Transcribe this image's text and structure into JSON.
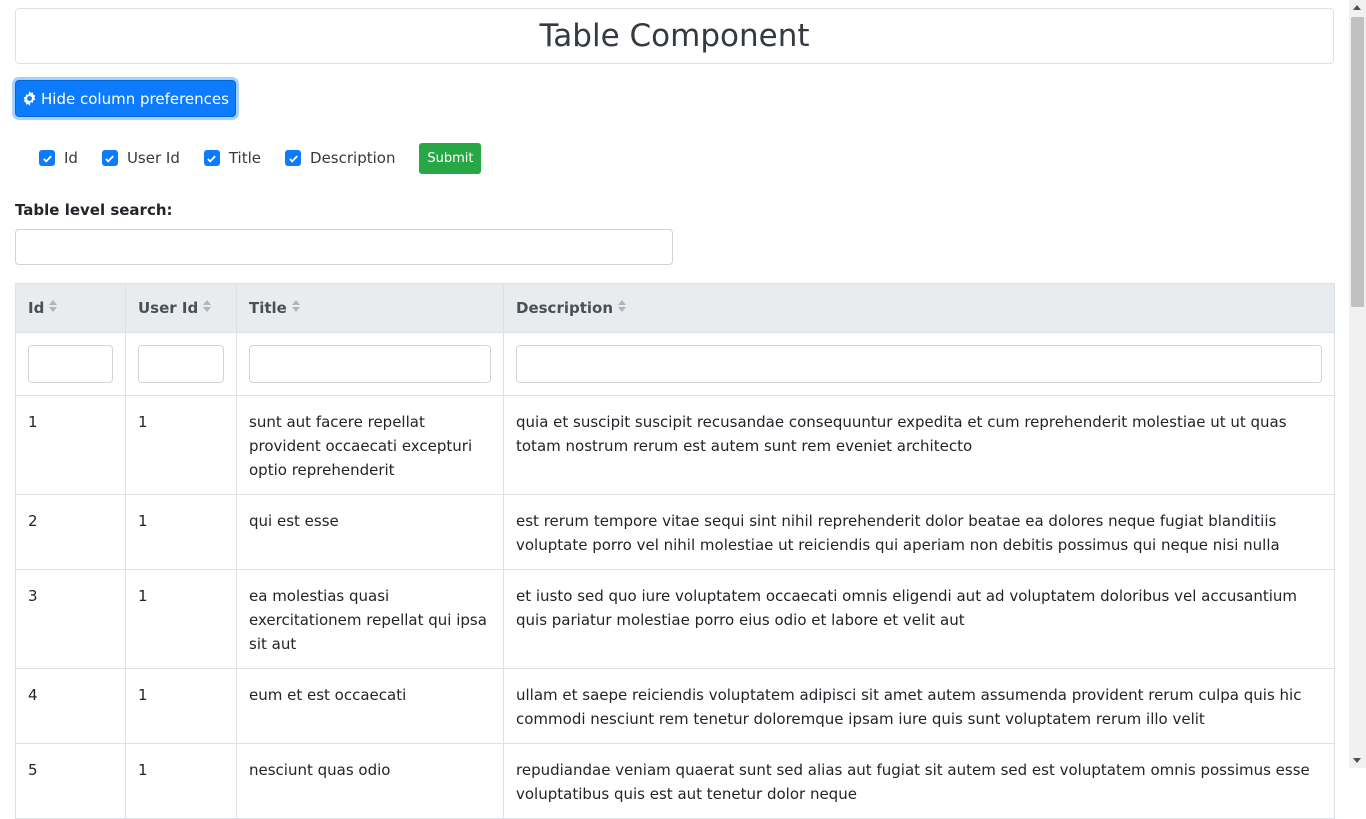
{
  "page": {
    "title": "Table Component"
  },
  "column_prefs": {
    "toggle_label": "Hide column preferences",
    "toggle_icon": "gear-icon",
    "accent_color": "#0d7bfe",
    "options": [
      {
        "label": "Id",
        "checked": true
      },
      {
        "label": "User Id",
        "checked": true
      },
      {
        "label": "Title",
        "checked": true
      },
      {
        "label": "Description",
        "checked": true
      }
    ],
    "submit_label": "Submit",
    "submit_color": "#28a745"
  },
  "search": {
    "label": "Table level search:",
    "value": ""
  },
  "table": {
    "columns": [
      "Id",
      "User Id",
      "Title",
      "Description"
    ],
    "rows": [
      {
        "id": "1",
        "user_id": "1",
        "title": "sunt aut facere repellat provident occaecati excepturi optio reprehenderit",
        "description": "quia et suscipit suscipit recusandae consequuntur expedita et cum reprehenderit molestiae ut ut quas totam nostrum rerum est autem sunt rem eveniet architecto"
      },
      {
        "id": "2",
        "user_id": "1",
        "title": "qui est esse",
        "description": "est rerum tempore vitae sequi sint nihil reprehenderit dolor beatae ea dolores neque fugiat blanditiis voluptate porro vel nihil molestiae ut reiciendis qui aperiam non debitis possimus qui neque nisi nulla"
      },
      {
        "id": "3",
        "user_id": "1",
        "title": "ea molestias quasi exercitationem repellat qui ipsa sit aut",
        "description": "et iusto sed quo iure voluptatem occaecati omnis eligendi aut ad voluptatem doloribus vel accusantium quis pariatur molestiae porro eius odio et labore et velit aut"
      },
      {
        "id": "4",
        "user_id": "1",
        "title": "eum et est occaecati",
        "description": "ullam et saepe reiciendis voluptatem adipisci sit amet autem assumenda provident rerum culpa quis hic commodi nesciunt rem tenetur doloremque ipsam iure quis sunt voluptatem rerum illo velit"
      },
      {
        "id": "5",
        "user_id": "1",
        "title": "nesciunt quas odio",
        "description": "repudiandae veniam quaerat sunt sed alias aut fugiat sit autem sed est voluptatem omnis possimus esse voluptatibus quis est aut tenetur dolor neque"
      }
    ]
  }
}
